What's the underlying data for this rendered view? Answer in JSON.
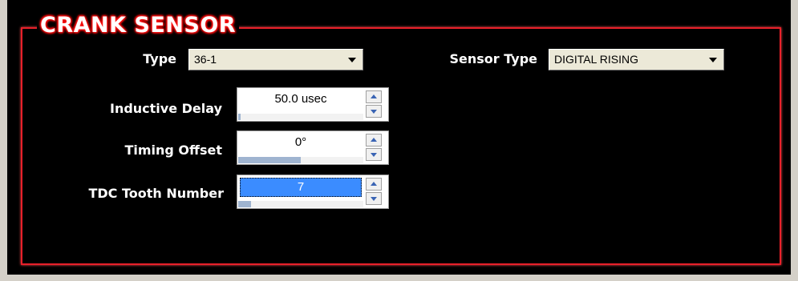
{
  "panel": {
    "title": "CRANK SENSOR"
  },
  "type": {
    "label": "Type",
    "value": "36-1"
  },
  "sensor_type": {
    "label": "Sensor Type",
    "value": "DIGITAL RISING"
  },
  "inductive_delay": {
    "label": "Inductive Delay",
    "value": "50.0 usec",
    "fill_fraction": 0.02
  },
  "timing_offset": {
    "label": "Timing Offset",
    "value": "0°",
    "fill_fraction": 0.5
  },
  "tdc_tooth_number": {
    "label": "TDC Tooth Number",
    "value": "7",
    "fill_fraction": 0.1
  },
  "colors": {
    "frame_red": "#e8202a",
    "selection_blue": "#3b8cff",
    "background": "#000000"
  }
}
